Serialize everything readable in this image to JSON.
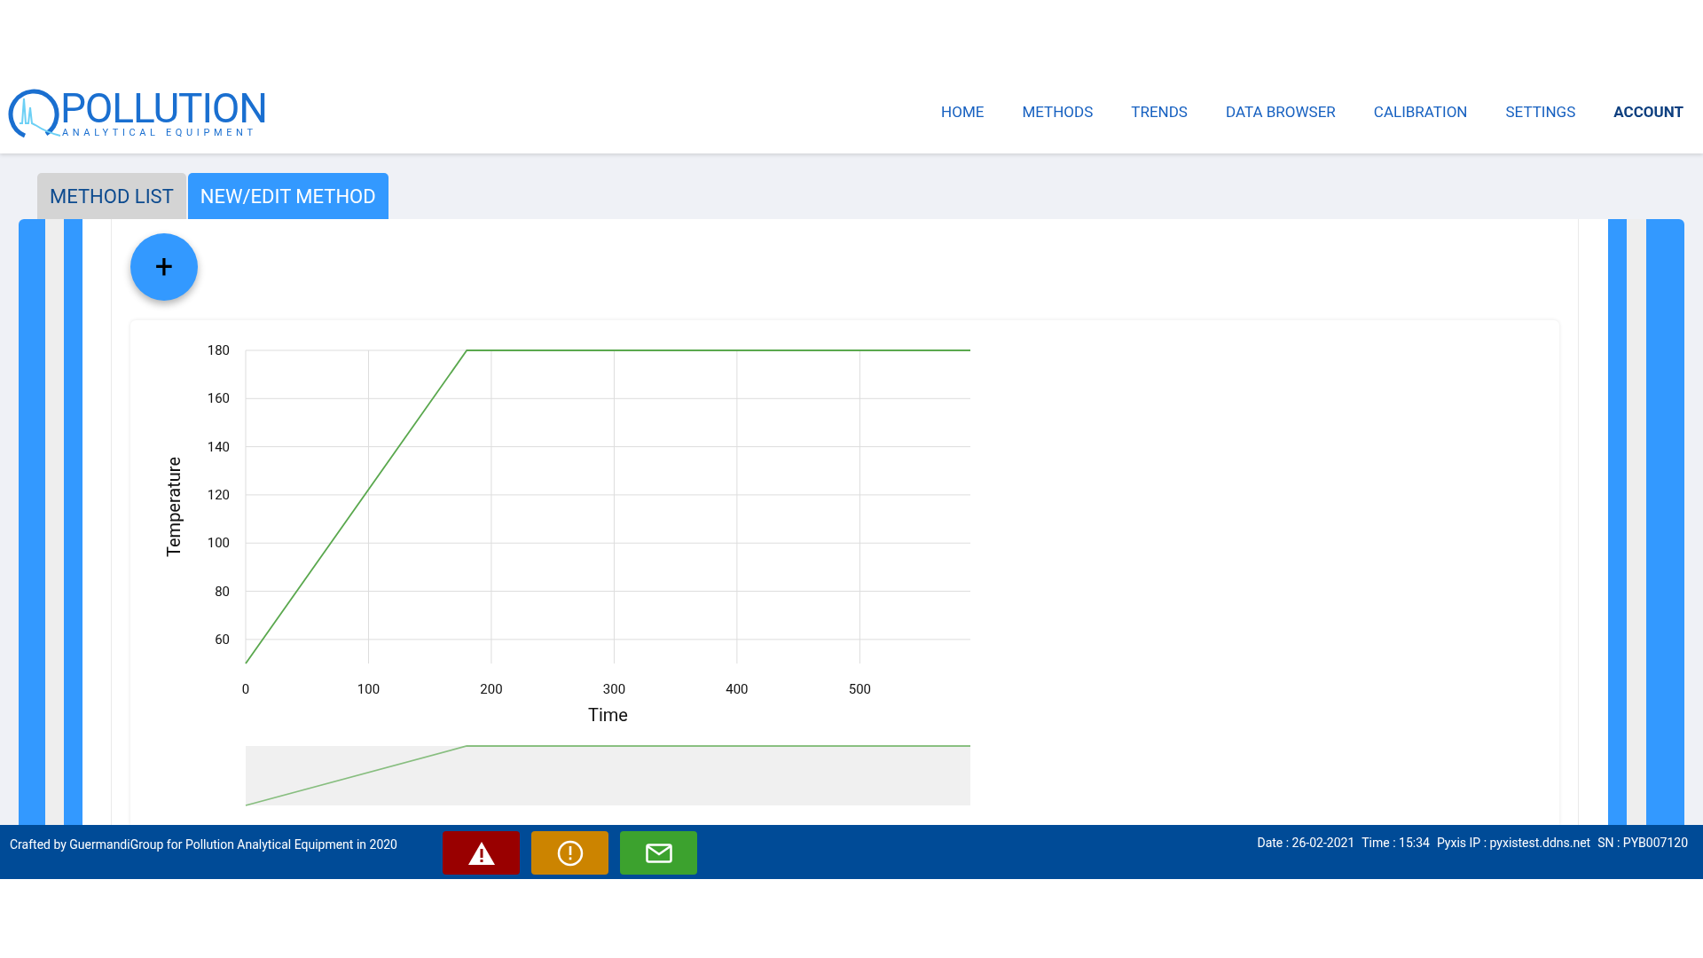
{
  "logo": {
    "name": "POLLUTION",
    "tagline": "ANALYTICAL EQUIPMENT"
  },
  "nav": [
    {
      "label": "HOME",
      "selected": false
    },
    {
      "label": "METHODS",
      "selected": false
    },
    {
      "label": "TRENDS",
      "selected": false
    },
    {
      "label": "DATA BROWSER",
      "selected": false
    },
    {
      "label": "CALIBRATION",
      "selected": false
    },
    {
      "label": "SETTINGS",
      "selected": false
    },
    {
      "label": "ACCOUNT",
      "selected": true
    }
  ],
  "tabs": [
    {
      "label": "METHOD LIST",
      "selected": false
    },
    {
      "label": "NEW/EDIT METHOD",
      "selected": true
    }
  ],
  "add_button": {
    "label": "+"
  },
  "chart": {
    "chart_data": {
      "type": "line",
      "xlabel": "Time",
      "ylabel": "Temperature",
      "x": [
        0,
        180,
        590
      ],
      "series": [
        {
          "color": "#5aa84e",
          "values": [
            50,
            180,
            180
          ]
        }
      ],
      "grid": true,
      "xlim": [
        0,
        590
      ],
      "ylim": [
        50,
        180
      ],
      "xticks": [
        0,
        100,
        200,
        300,
        400,
        500
      ],
      "yticks": [
        60,
        80,
        100,
        120,
        140,
        160,
        180
      ]
    }
  },
  "footer": {
    "credit": "Crafted by GuermandiGroup for Pollution Analytical Equipment in 2020",
    "buttons": [
      {
        "kind": "alarm",
        "color": "#990000"
      },
      {
        "kind": "warning",
        "color": "#cc8400"
      },
      {
        "kind": "message",
        "color": "#3ca22e"
      }
    ],
    "info": [
      "Date : 26-02-2021",
      "Time : 15:34",
      "Pyxis IP : pyxistest.ddns.net",
      "SN : PYB007120"
    ]
  }
}
